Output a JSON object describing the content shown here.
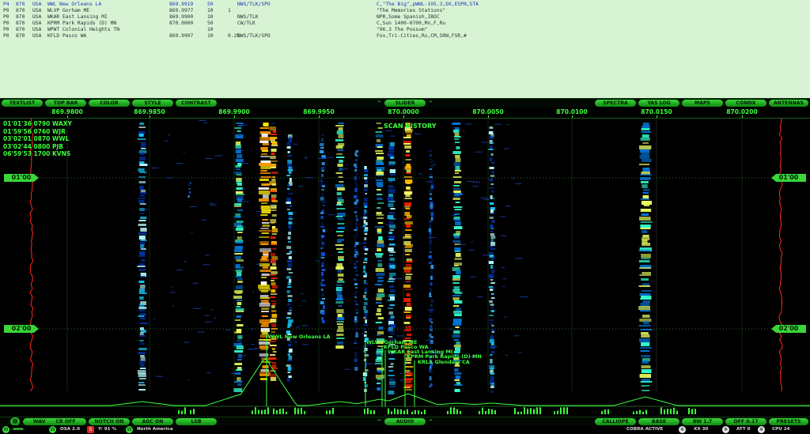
{
  "textlist": {
    "rows": [
      {
        "pri": "P4",
        "freq": "870",
        "country": "USA",
        "station": "WWL New Orleans LA",
        "mhz": "869.9919",
        "power": "50",
        "extra": "",
        "format": "NWS/TLK/SPO",
        "notes": "C,\"The Big\",pWWL-105.3,DX,ESPN,STA"
      },
      {
        "pri": "P0",
        "freq": "870",
        "country": "USA",
        "station": "WLVP Gorham ME",
        "mhz": "869.9977",
        "power": "10",
        "extra": "1",
        "format": "",
        "notes": "\"The Memories Stations\""
      },
      {
        "pri": "P0",
        "freq": "870",
        "country": "USA",
        "station": "WKAR East Lansing MI",
        "mhz": "869.9900",
        "power": "10",
        "extra": "",
        "format": "NWS/TLK",
        "notes": "NPR,Some Spanish,IBOC"
      },
      {
        "pri": "P0",
        "freq": "870",
        "country": "USA",
        "station": "KPRM Park Rapids (D) MN",
        "mhz": "870.0000",
        "power": "50",
        "extra": "",
        "format": "CW/TLK",
        "notes": "C,Sun 1400-0700,Mn,F,Ru"
      },
      {
        "pri": "P0",
        "freq": "870",
        "country": "USA",
        "station": "WPWT Colonial Heights TN",
        "mhz": "",
        "power": "10",
        "extra": "",
        "format": "",
        "notes": "\"96.3 The Possum\""
      },
      {
        "pri": "P0",
        "freq": "870",
        "country": "USA",
        "station": "KFLD Pasco WA",
        "mhz": "869.9907",
        "power": "10",
        "extra": "0.25",
        "format": "NWS/TLK/SPO",
        "notes": "Fox,Tri-Cities,Ru,CM,SRN,FSR,#"
      }
    ]
  },
  "top_buttons": {
    "textlist": "TEXTLIST",
    "topbar": "TOP BAR",
    "color": "COLOR",
    "style": "STYLE",
    "contrast": "CONTRAST",
    "slider": "SLIDER",
    "spectra": "SPECTRA",
    "yaslog": "YAS LOG",
    "maps": "MAPS",
    "condx": "CONDX",
    "antennas": "ANTENNAS"
  },
  "frequency_scale": [
    "869.9800",
    "869.9850",
    "869.9900",
    "869.9950",
    "870.0000",
    "870.0050",
    "870.0100",
    "870.0150",
    "870.0200"
  ],
  "waterfall": {
    "overlay_title": "SCAN HISTORY",
    "scan_history": [
      "01'01'36 0790 WAXY",
      "01'59'56 0760 WJR",
      "03'02'01 0870 WWL",
      "03'02'44 0800 PJB",
      "06'59'53 1700 KVNS"
    ],
    "time_marks": [
      "01'00",
      "02'00"
    ],
    "station_labels": [
      {
        "text": "WWL New Orleans LA"
      },
      {
        "text": "WLVP Gorham ME"
      },
      {
        "text": "KFLD Pasco WA"
      },
      {
        "text": "WKAR East Lansing MI"
      },
      {
        "text": "KPRM Park Rapids (D) MN"
      },
      {
        "text": "KRLA Glendale CA"
      }
    ]
  },
  "bottom_buttons": {
    "vol": "⓾",
    "waw": "WAV 10",
    "cr": "CR OFF",
    "notch": "NOTCH ON",
    "agc": "AGC ON",
    "lsb": "LSB",
    "audio": "AUDIO",
    "calliope": "CALLIOPE",
    "base": "BASE",
    "bw": "BW 1.7",
    "off": "OFF 0.17",
    "presets": "PRESETS"
  },
  "status": {
    "osa": "OSA 2.0",
    "y": "Y: 91 %",
    "region": "North America",
    "cobra": "COBRA ACTIVE",
    "xx": "XX 30",
    "att": "ATT 0",
    "cpu": "CPU 24"
  },
  "colors": {
    "accent": "#3ad63a",
    "text_bg": "#d8f3d4",
    "selected_row": "#1c37b8",
    "trace": "#ff2a1a"
  }
}
